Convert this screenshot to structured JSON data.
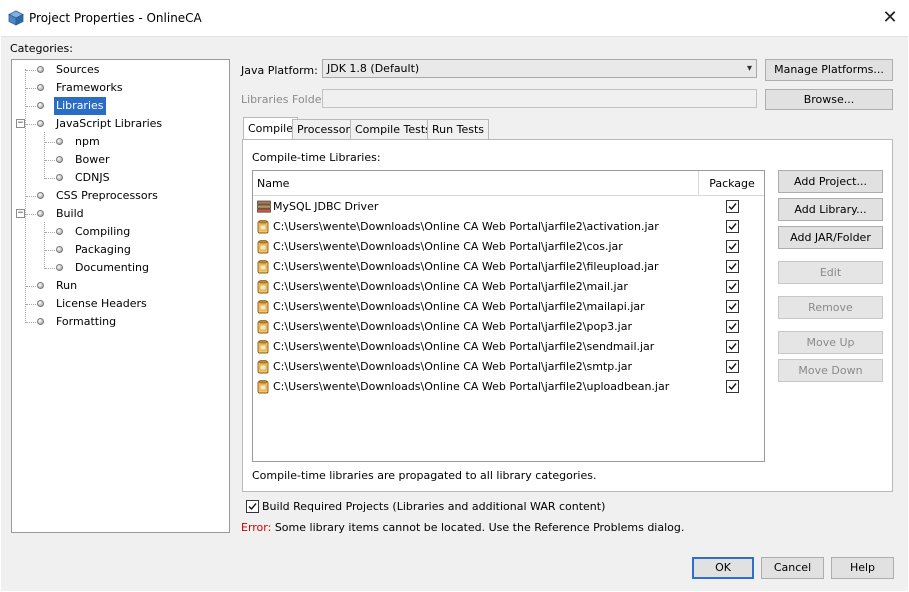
{
  "window": {
    "title": "Project Properties - OnlineCA",
    "close_glyph": "✕"
  },
  "categories": {
    "label": "Categories:",
    "items": [
      {
        "label": "Sources"
      },
      {
        "label": "Frameworks"
      },
      {
        "label": "Libraries",
        "selected": true
      },
      {
        "label": "JavaScript Libraries",
        "expanded": true
      },
      {
        "label": "npm"
      },
      {
        "label": "Bower"
      },
      {
        "label": "CDNJS"
      },
      {
        "label": "CSS Preprocessors"
      },
      {
        "label": "Build",
        "expanded": true
      },
      {
        "label": "Compiling"
      },
      {
        "label": "Packaging"
      },
      {
        "label": "Documenting"
      },
      {
        "label": "Run"
      },
      {
        "label": "License Headers"
      },
      {
        "label": "Formatting"
      }
    ],
    "toggle_glyph": "−"
  },
  "platform": {
    "label": "Java Platform:",
    "value": "JDK 1.8 (Default)",
    "arrow": "▾",
    "manage_button": "Manage Platforms..."
  },
  "libraries_folder": {
    "label": "Libraries Folder:",
    "value": "",
    "browse_button": "Browse..."
  },
  "tabs": [
    {
      "label": "Compile",
      "active": true
    },
    {
      "label": "Processor"
    },
    {
      "label": "Compile Tests"
    },
    {
      "label": "Run Tests"
    }
  ],
  "compile": {
    "section_label": "Compile-time Libraries:",
    "columns": {
      "name": "Name",
      "package": "Package"
    },
    "rows": [
      {
        "name": "MySQL JDBC Driver",
        "package": true,
        "icon": "library-icon"
      },
      {
        "name": "C:\\Users\\wente\\Downloads\\Online CA Web Portal\\jarfile2\\activation.jar",
        "package": true,
        "icon": "jar-icon"
      },
      {
        "name": "C:\\Users\\wente\\Downloads\\Online CA Web Portal\\jarfile2\\cos.jar",
        "package": true,
        "icon": "jar-icon"
      },
      {
        "name": "C:\\Users\\wente\\Downloads\\Online CA Web Portal\\jarfile2\\fileupload.jar",
        "package": true,
        "icon": "jar-icon"
      },
      {
        "name": "C:\\Users\\wente\\Downloads\\Online CA Web Portal\\jarfile2\\mail.jar",
        "package": true,
        "icon": "jar-icon"
      },
      {
        "name": "C:\\Users\\wente\\Downloads\\Online CA Web Portal\\jarfile2\\mailapi.jar",
        "package": true,
        "icon": "jar-icon"
      },
      {
        "name": "C:\\Users\\wente\\Downloads\\Online CA Web Portal\\jarfile2\\pop3.jar",
        "package": true,
        "icon": "jar-icon"
      },
      {
        "name": "C:\\Users\\wente\\Downloads\\Online CA Web Portal\\jarfile2\\sendmail.jar",
        "package": true,
        "icon": "jar-icon"
      },
      {
        "name": "C:\\Users\\wente\\Downloads\\Online CA Web Portal\\jarfile2\\smtp.jar",
        "package": true,
        "icon": "jar-icon"
      },
      {
        "name": "C:\\Users\\wente\\Downloads\\Online CA Web Portal\\jarfile2\\uploadbean.jar",
        "package": true,
        "icon": "jar-icon"
      }
    ],
    "buttons": {
      "add_project": "Add Project...",
      "add_library": "Add Library...",
      "add_jar": "Add JAR/Folder",
      "edit": "Edit",
      "remove": "Remove",
      "move_up": "Move Up",
      "move_down": "Move Down"
    },
    "note": "Compile-time libraries are propagated to all library categories."
  },
  "build_required": {
    "label": "Build Required Projects (Libraries and additional WAR content)",
    "checked": true
  },
  "error": {
    "prefix": "Error:",
    "message": " Some library items cannot be located. Use the Reference Problems dialog."
  },
  "footer": {
    "ok": "OK",
    "cancel": "Cancel",
    "help": "Help"
  },
  "colors": {
    "selection": "#2b6cc4",
    "error": "#d00000",
    "default_button_border": "#2f6fd0"
  }
}
